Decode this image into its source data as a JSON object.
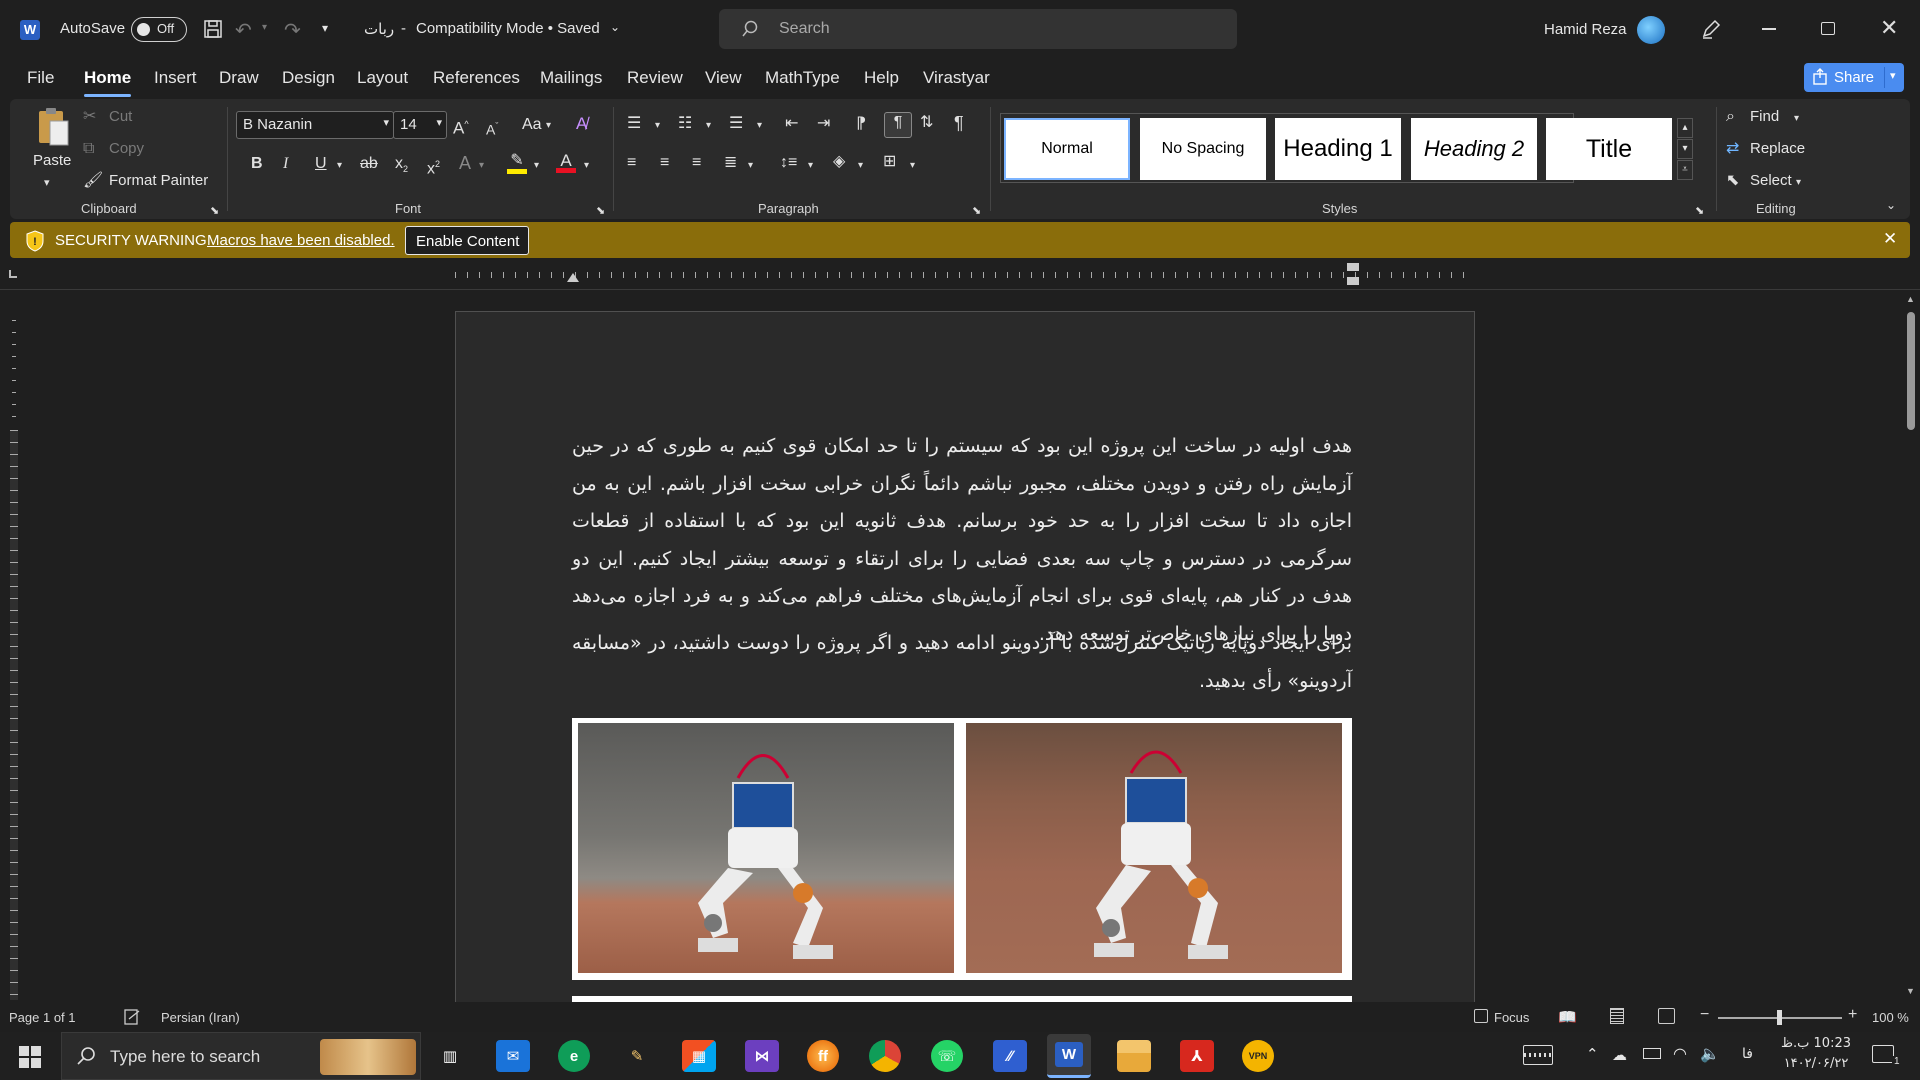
{
  "titlebar": {
    "autosave_label": "AutoSave",
    "autosave_state": "Off",
    "doc_title": "ربات",
    "doc_status": "Compatibility Mode • Saved",
    "search_placeholder": "Search",
    "user_name": "Hamid Reza"
  },
  "tabs": [
    "File",
    "Home",
    "Insert",
    "Draw",
    "Design",
    "Layout",
    "References",
    "Mailings",
    "Review",
    "View",
    "MathType",
    "Help",
    "Virastyar"
  ],
  "share_label": "Share",
  "ribbon": {
    "clipboard": {
      "paste": "Paste",
      "cut": "Cut",
      "copy": "Copy",
      "format_painter": "Format Painter",
      "label": "Clipboard"
    },
    "font": {
      "name": "B Nazanin",
      "size": "14",
      "case_label": "Aa",
      "label": "Font"
    },
    "paragraph": {
      "label": "Paragraph"
    },
    "styles": {
      "items": [
        "Normal",
        "No Spacing",
        "Heading 1",
        "Heading 2",
        "Title"
      ],
      "label": "Styles"
    },
    "editing": {
      "find": "Find",
      "replace": "Replace",
      "select": "Select",
      "label": "Editing"
    }
  },
  "warning": {
    "title": "SECURITY WARNING",
    "message": "Macros have been disabled.",
    "button": "Enable Content"
  },
  "document": {
    "paragraph1": "هدف اولیه در ساخت این پروژه این بود که سیستم را تا حد امکان قوی کنیم به طوری که در حین آزمایش راه رفتن و دویدن مختلف، مجبور نباشم دائماً نگران خرابی سخت افزار باشم. این به من اجازه داد تا سخت افزار را به حد خود برسانم. هدف ثانویه این بود که با استفاده از قطعات سرگرمی در دسترس و چاپ سه بعدی فضایی را برای ارتقاء و توسعه بیشتر ایجاد کنیم. این دو هدف در کنار هم، پایه‌ای قوی برای انجام آزمایش‌های مختلف فراهم می‌کند و به فرد اجازه می‌دهد دوپا را برای نیازهای خاص‌تر توسعه دهد.",
    "paragraph2": "برای ایجاد دوپایه رباتیک کنترل‌شده با آردوینو ادامه دهید و اگر پروژه را دوست داشتید، در «مسابقه آردوینو» رأی بدهید."
  },
  "status": {
    "page": "Page 1 of 1",
    "language": "Persian (Iran)",
    "focus": "Focus",
    "zoom": "100 %"
  },
  "taskbar": {
    "search_placeholder": "Type here to search",
    "lang": "فا",
    "time": "10:23 ب.ظ",
    "date": "۱۴۰۲/۰۶/۲۲",
    "notification_count": "1"
  },
  "colors": {
    "accent": "#7cb4ff",
    "warning": "#8a6d0b",
    "share": "#4a8cf0"
  }
}
